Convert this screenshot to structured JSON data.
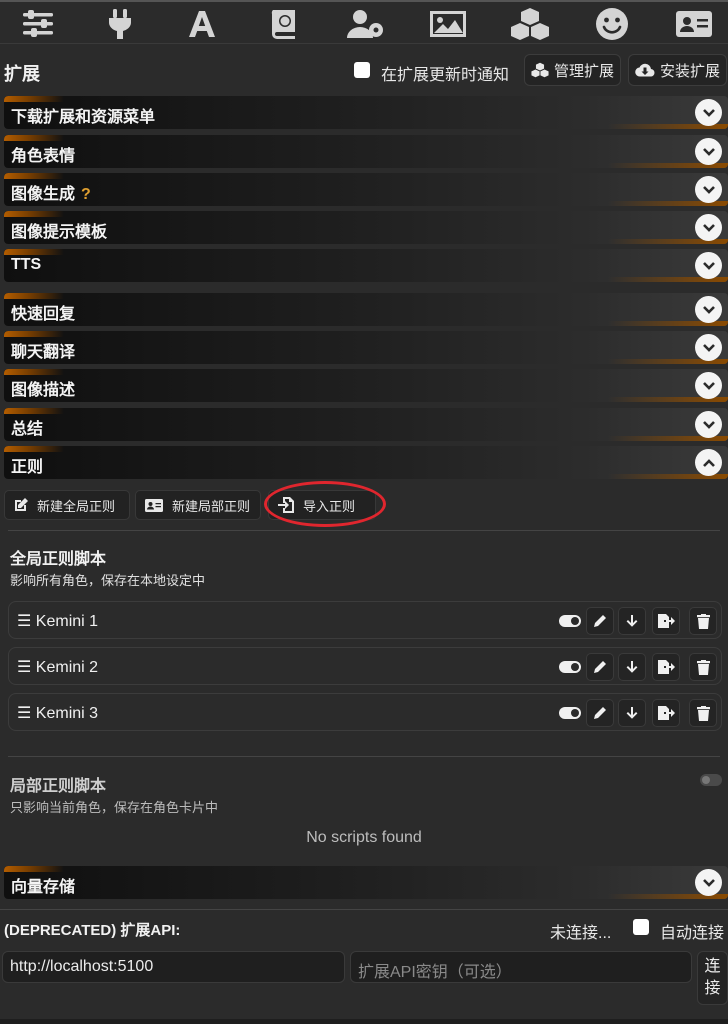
{
  "topbar": {
    "icons": [
      "sliders-icon",
      "plug-icon",
      "font-icon",
      "book-atlas-icon",
      "user-gear-icon",
      "image-icon",
      "cubes-icon",
      "face-smile-icon",
      "address-card-icon"
    ]
  },
  "header": {
    "title": "扩展",
    "notify_label": "在扩展更新时通知",
    "manage_label": "管理扩展",
    "install_label": "安装扩展"
  },
  "drawers": [
    {
      "label": "下载扩展和资源菜单",
      "expanded": false
    },
    {
      "label": "角色表情",
      "expanded": false
    },
    {
      "label": "图像生成",
      "help": "?",
      "expanded": false
    },
    {
      "label": "图像提示模板",
      "expanded": false
    },
    {
      "label": "TTS",
      "expanded": false
    },
    {
      "label": "快速回复",
      "expanded": false
    },
    {
      "label": "聊天翻译",
      "expanded": false
    },
    {
      "label": "图像描述",
      "expanded": false
    },
    {
      "label": "总结",
      "expanded": false
    },
    {
      "label": "正则",
      "expanded": true
    },
    {
      "label": "向量存储",
      "expanded": false
    }
  ],
  "regex": {
    "new_global": "新建全局正则",
    "new_local": "新建局部正则",
    "import": "导入正则",
    "global_title": "全局正则脚本",
    "global_sub": "影响所有角色，保存在本地设定中",
    "scripts": [
      {
        "name": "Kemini 1",
        "enabled": true
      },
      {
        "name": "Kemini 2",
        "enabled": true
      },
      {
        "name": "Kemini 3",
        "enabled": true
      }
    ],
    "local_title": "局部正则脚本",
    "local_sub": "只影响当前角色，保存在角色卡片中",
    "local_enabled": false,
    "no_scripts": "No scripts found"
  },
  "api": {
    "title": "(DEPRECATED) 扩展API:",
    "status": "未连接...",
    "auto_connect": "自动连接",
    "url_value": "http://localhost:5100",
    "key_placeholder": "扩展API密钥（可选）",
    "connect_line1": "连",
    "connect_line2": "接"
  },
  "colors": {
    "background": "#2b2b2b",
    "annotation": "#e0262e",
    "help": "#e0a030"
  }
}
